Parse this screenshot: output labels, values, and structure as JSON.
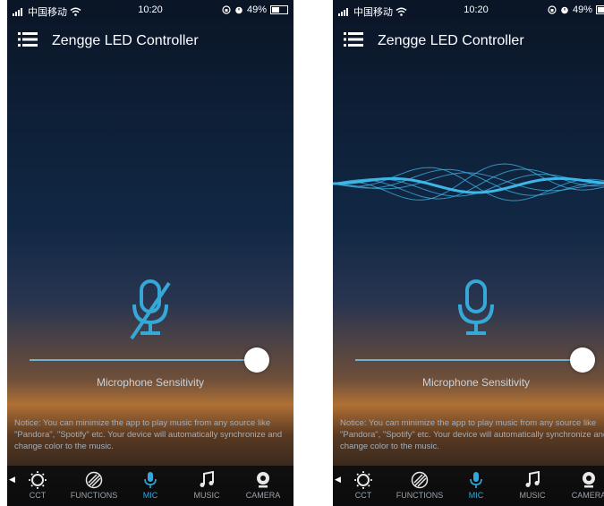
{
  "status_bar": {
    "carrier": "中国移动",
    "time": "10:20",
    "battery": "49%",
    "battery_level": 0.49
  },
  "header": {
    "title": "Zengge LED Controller"
  },
  "microphone": {
    "sensitivity_label": "Microphone Sensitivity",
    "sensitivity_level": 1.0
  },
  "notice": "Notice: You can minimize the app to play music from any source like \"Pandora\", \"Spotify\" etc. Your device will automatically synchronize and change color to the music.",
  "tabs": [
    {
      "label": "CCT",
      "icon": "sun-icon"
    },
    {
      "label": "FUNCTIONS",
      "icon": "striped-circle-icon"
    },
    {
      "label": "MIC",
      "icon": "mic-icon",
      "active": true
    },
    {
      "label": "MUSIC",
      "icon": "music-note-icon"
    },
    {
      "label": "CAMERA",
      "icon": "camera-icon"
    }
  ],
  "colors": {
    "accent": "#35a8d8",
    "wave": "#3fb6e8"
  }
}
